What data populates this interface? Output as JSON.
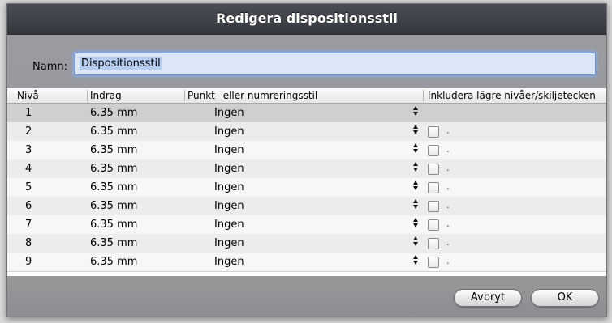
{
  "dialog": {
    "title": "Redigera dispositionsstil"
  },
  "name_field": {
    "label": "Namn:",
    "value": "Dispositionsstil"
  },
  "table": {
    "headers": [
      "Nivå",
      "Indrag",
      "Punkt– eller numreringsstil",
      "Inkludera lägre nivåer/skiljetecken"
    ],
    "rows": [
      {
        "level": "1",
        "indent": "6.35 mm",
        "style": "Ingen",
        "has_checkbox": false,
        "selected": true
      },
      {
        "level": "2",
        "indent": "6.35 mm",
        "style": "Ingen",
        "has_checkbox": true,
        "separator": "."
      },
      {
        "level": "3",
        "indent": "6.35 mm",
        "style": "Ingen",
        "has_checkbox": true,
        "separator": "."
      },
      {
        "level": "4",
        "indent": "6.35 mm",
        "style": "Ingen",
        "has_checkbox": true,
        "separator": "."
      },
      {
        "level": "5",
        "indent": "6.35 mm",
        "style": "Ingen",
        "has_checkbox": true,
        "separator": "."
      },
      {
        "level": "6",
        "indent": "6.35 mm",
        "style": "Ingen",
        "has_checkbox": true,
        "separator": "."
      },
      {
        "level": "7",
        "indent": "6.35 mm",
        "style": "Ingen",
        "has_checkbox": true,
        "separator": "."
      },
      {
        "level": "8",
        "indent": "6.35 mm",
        "style": "Ingen",
        "has_checkbox": true,
        "separator": "."
      },
      {
        "level": "9",
        "indent": "6.35 mm",
        "style": "Ingen",
        "has_checkbox": true,
        "separator": "."
      }
    ]
  },
  "buttons": {
    "cancel": "Avbryt",
    "ok": "OK"
  }
}
